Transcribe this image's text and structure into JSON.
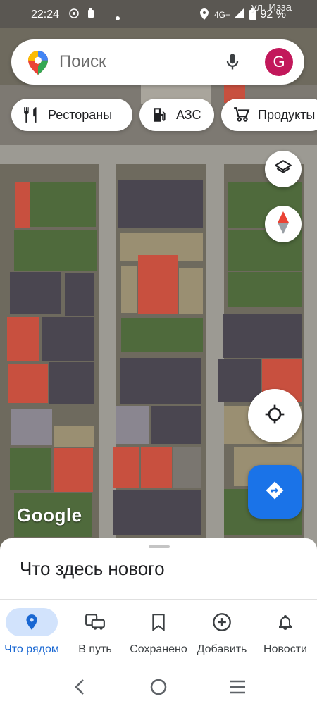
{
  "status_bar": {
    "time": "22:24",
    "network": "4G+",
    "battery": "92 %"
  },
  "map": {
    "street_label": "ул. Изза",
    "attribution": "Google"
  },
  "search": {
    "placeholder": "Поиск",
    "avatar_letter": "G"
  },
  "chips": [
    {
      "label": "Рестораны",
      "icon": "restaurant-icon"
    },
    {
      "label": "АЗС",
      "icon": "gas-station-icon"
    },
    {
      "label": "Продукты",
      "icon": "cart-icon"
    }
  ],
  "sheet": {
    "title": "Что здесь нового"
  },
  "bottom_nav": [
    {
      "label": "Что рядом",
      "icon": "place-pin-icon",
      "active": true
    },
    {
      "label": "В путь",
      "icon": "commute-car-icon",
      "active": false
    },
    {
      "label": "Сохранено",
      "icon": "bookmark-icon",
      "active": false
    },
    {
      "label": "Добавить",
      "icon": "add-circle-icon",
      "active": false
    },
    {
      "label": "Новости",
      "icon": "bell-icon",
      "active": false
    }
  ],
  "colors": {
    "accent": "#1a73e8",
    "avatar": "#c2185b",
    "active_tab_bg": "#d2e3fc"
  }
}
